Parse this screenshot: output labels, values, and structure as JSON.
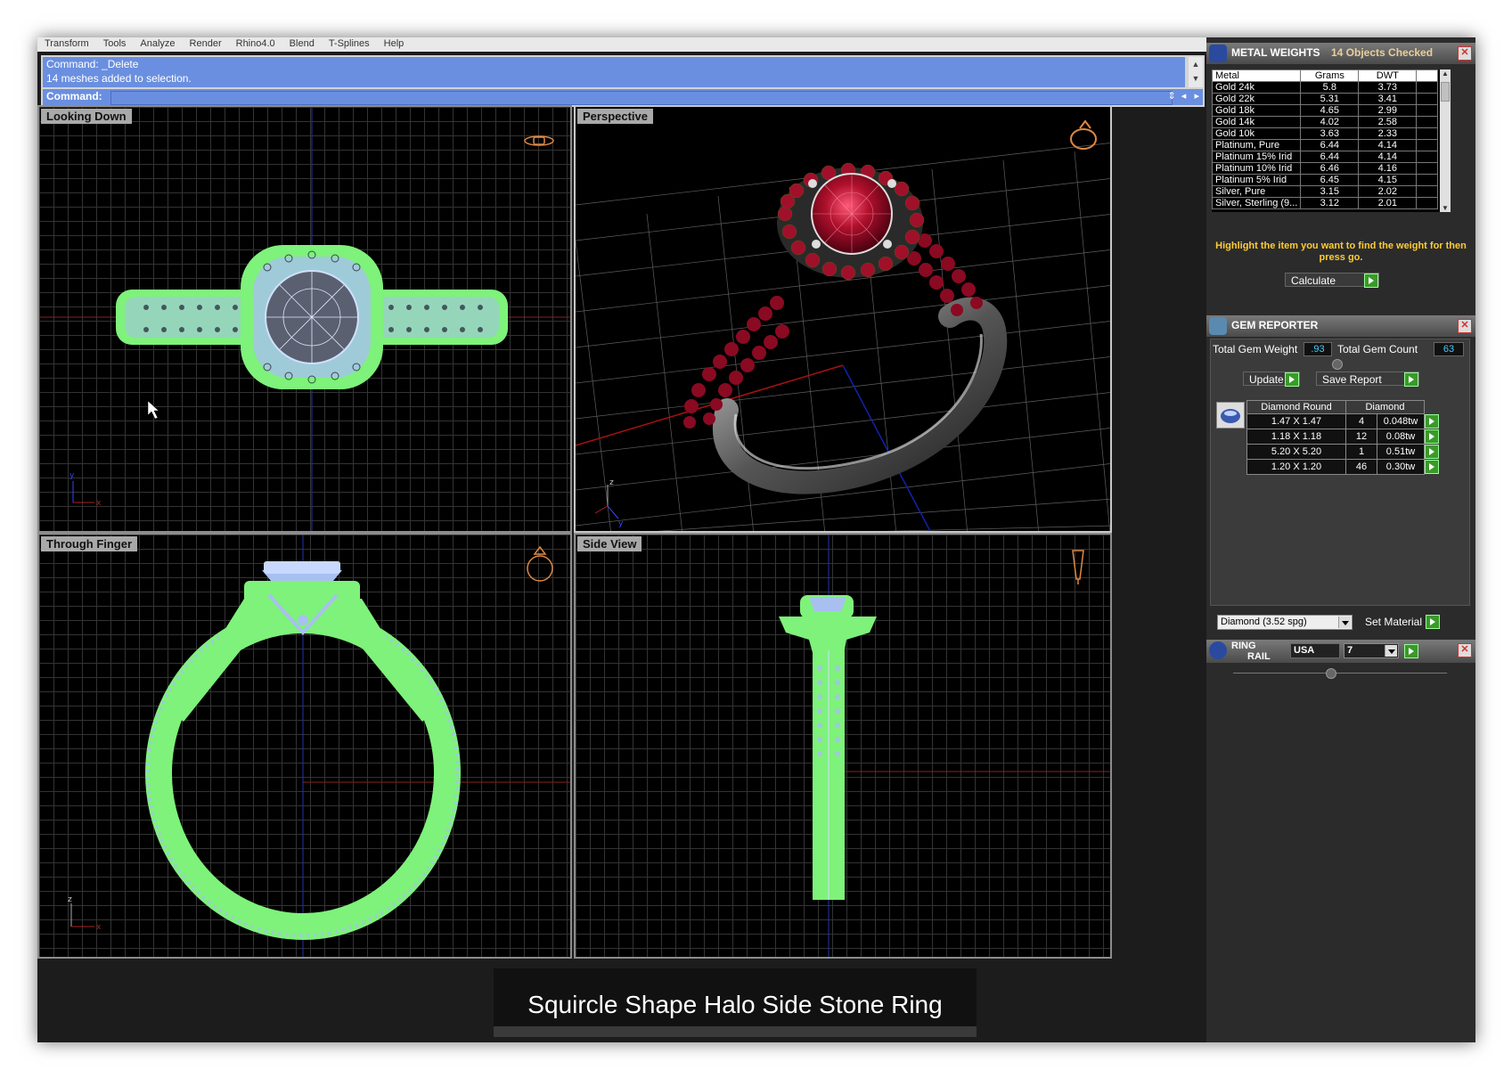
{
  "menu": [
    "Transform",
    "Tools",
    "Analyze",
    "Render",
    "Rhino4.0",
    "Blend",
    "T-Splines",
    "Help"
  ],
  "command": {
    "history": [
      "Command: _Delete",
      "14 meshes added to selection."
    ],
    "label": "Command:",
    "value": ""
  },
  "viewports": {
    "top_left": {
      "title": "Looking Down"
    },
    "top_right": {
      "title": "Perspective"
    },
    "bottom_left": {
      "title": "Through Finger"
    },
    "bottom_right": {
      "title": "Side View"
    }
  },
  "caption": "Squircle Shape Halo Side Stone Ring",
  "metal_weights": {
    "title": "METAL WEIGHTS",
    "status": "14 Objects Checked",
    "columns": [
      "Metal",
      "Grams",
      "DWT"
    ],
    "rows": [
      [
        "Gold 24k",
        "5.8",
        "3.73"
      ],
      [
        "Gold 22k",
        "5.31",
        "3.41"
      ],
      [
        "Gold 18k",
        "4.65",
        "2.99"
      ],
      [
        "Gold 14k",
        "4.02",
        "2.58"
      ],
      [
        "Gold 10k",
        "3.63",
        "2.33"
      ],
      [
        "Platinum, Pure",
        "6.44",
        "4.14"
      ],
      [
        "Platinum 15% Irid",
        "6.44",
        "4.14"
      ],
      [
        "Platinum 10% Irid",
        "6.46",
        "4.16"
      ],
      [
        "Platinum 5% Irid",
        "6.45",
        "4.15"
      ],
      [
        "Silver, Pure",
        "3.15",
        "2.02"
      ],
      [
        "Silver, Sterling (9...",
        "3.12",
        "2.01"
      ]
    ],
    "hint": "Highlight the item you want to find the weight for then press go.",
    "calculate_label": "Calculate"
  },
  "gem_reporter": {
    "title": "GEM REPORTER",
    "total_weight_label": "Total Gem Weight",
    "total_weight": ".93",
    "total_count_label": "Total Gem Count",
    "total_count": "63",
    "update_label": "Update",
    "save_label": "Save Report",
    "columns": [
      "Diamond Round",
      "Diamond"
    ],
    "rows": [
      [
        "1.47 X 1.47",
        "4",
        "0.048tw"
      ],
      [
        "1.18 X 1.18",
        "12",
        "0.08tw"
      ],
      [
        "5.20 X 5.20",
        "1",
        "0.51tw"
      ],
      [
        "1.20 X 1.20",
        "46",
        "0.30tw"
      ]
    ],
    "material_select": "Diamond     (3.52 spg)",
    "set_material_label": "Set Material"
  },
  "ring_rail": {
    "title_line1": "RING",
    "title_line2": "RAIL",
    "country": "USA",
    "size": "7"
  },
  "colors": {
    "highlight_green": "#7ef27a",
    "wire_blue": "#a8c0f0",
    "ruby": "#a0102a",
    "command_blue": "#6a8fe0",
    "hint_yellow": "#ffcc33"
  }
}
